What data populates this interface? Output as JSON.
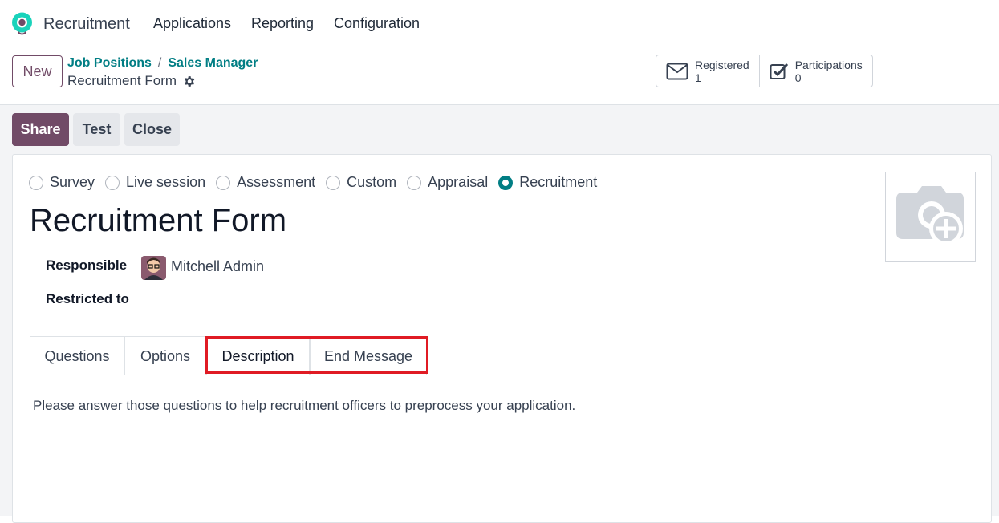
{
  "app": {
    "name": "Recruitment"
  },
  "nav": {
    "items": [
      "Applications",
      "Reporting",
      "Configuration"
    ]
  },
  "control": {
    "new_label": "New",
    "breadcrumb": [
      "Job Positions",
      "Sales Manager"
    ],
    "separator": "/",
    "record_title": "Recruitment Form",
    "stats": [
      {
        "label": "Registered",
        "value": "1",
        "icon": "envelope-icon"
      },
      {
        "label": "Participations",
        "value": "0",
        "icon": "checkbox-icon"
      }
    ]
  },
  "actions": {
    "share": "Share",
    "test": "Test",
    "close": "Close"
  },
  "form": {
    "survey_types": [
      "Survey",
      "Live session",
      "Assessment",
      "Custom",
      "Appraisal",
      "Recruitment"
    ],
    "selected_type": "Recruitment",
    "title": "Recruitment Form",
    "responsible_label": "Responsible",
    "responsible_value": "Mitchell Admin",
    "restricted_label": "Restricted to",
    "restricted_value": ""
  },
  "tabs": {
    "items": [
      "Questions",
      "Options",
      "Description",
      "End Message"
    ],
    "active": "Description"
  },
  "description_text": "Please answer those questions to help recruitment officers to preprocess your application.",
  "colors": {
    "brand": "#714b67",
    "link": "#017e84",
    "highlight": "#e01b24"
  }
}
